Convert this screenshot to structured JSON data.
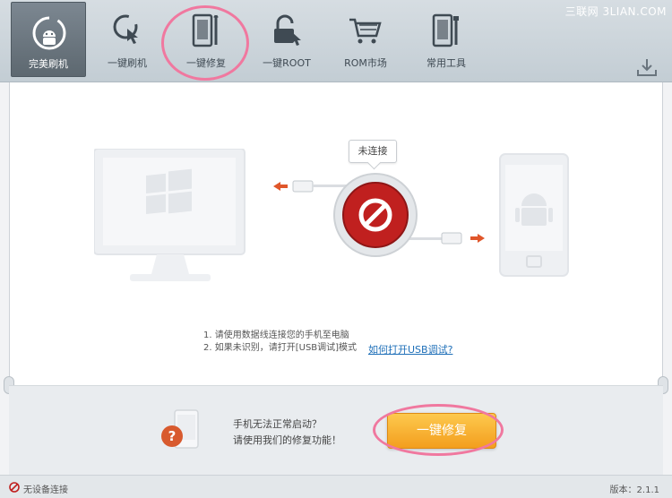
{
  "watermark": "三联网 3LIAN.COM",
  "toolbar": {
    "tools": [
      {
        "label": "完美刷机",
        "icon": "android-refresh-icon",
        "active": true
      },
      {
        "label": "一键刷机",
        "icon": "touch-refresh-icon"
      },
      {
        "label": "一键修复",
        "icon": "phone-wrench-icon"
      },
      {
        "label": "一键ROOT",
        "icon": "unlock-touch-icon"
      },
      {
        "label": "ROM市场",
        "icon": "shopping-cart-icon"
      },
      {
        "label": "常用工具",
        "icon": "phone-tools-icon"
      }
    ],
    "download_icon": "download-icon"
  },
  "connection": {
    "bubble": "未连接",
    "state_icon": "no-entry-icon"
  },
  "instructions": {
    "line1": "1. 请使用数据线连接您的手机至电脑",
    "line2": "2. 如果未识别，请打开[USB调试]模式",
    "link": "如何打开USB调试?"
  },
  "repair": {
    "line1": "手机无法正常启动？",
    "line2": "请使用我们的修复功能！",
    "button": "一键修复",
    "help_glyph": "?"
  },
  "status": {
    "text": "无设备连接",
    "version": "版本：2.1.1"
  },
  "colors": {
    "accent_orange": "#f5a623",
    "annotation_pink": "#f0789f",
    "stop_red": "#c0201f",
    "link_blue": "#1e6fb8"
  }
}
